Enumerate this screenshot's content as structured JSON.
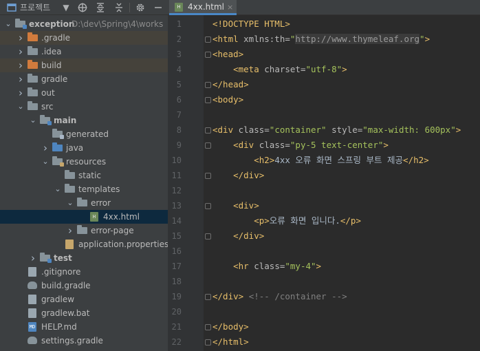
{
  "project_panel": {
    "title": "프로젝트",
    "tree": [
      {
        "indent": 0,
        "arrow": "open",
        "icon": "module",
        "label": "exception",
        "bold": true,
        "path": "D:\\dev\\Spring\\4\\works",
        "row": "normal"
      },
      {
        "indent": 1,
        "arrow": "closed",
        "icon": "folder-orange",
        "label": ".gradle",
        "row": "excluded"
      },
      {
        "indent": 1,
        "arrow": "closed",
        "icon": "folder-grey",
        "label": ".idea",
        "row": "normal"
      },
      {
        "indent": 1,
        "arrow": "closed",
        "icon": "folder-orange",
        "label": "build",
        "row": "excluded"
      },
      {
        "indent": 1,
        "arrow": "closed",
        "icon": "folder-grey",
        "label": "gradle",
        "row": "normal"
      },
      {
        "indent": 1,
        "arrow": "closed",
        "icon": "folder-grey",
        "label": "out",
        "row": "normal"
      },
      {
        "indent": 1,
        "arrow": "open",
        "icon": "folder-grey",
        "label": "src",
        "row": "normal"
      },
      {
        "indent": 2,
        "arrow": "open",
        "icon": "folder-module",
        "label": "main",
        "bold": true,
        "row": "normal"
      },
      {
        "indent": 3,
        "arrow": "none",
        "icon": "folder-generated",
        "label": "generated",
        "row": "normal"
      },
      {
        "indent": 3,
        "arrow": "closed",
        "icon": "folder-blue",
        "label": "java",
        "row": "normal"
      },
      {
        "indent": 3,
        "arrow": "open",
        "icon": "folder-resources",
        "label": "resources",
        "row": "normal"
      },
      {
        "indent": 4,
        "arrow": "none",
        "icon": "folder-grey",
        "label": "static",
        "row": "normal"
      },
      {
        "indent": 4,
        "arrow": "open",
        "icon": "folder-grey",
        "label": "templates",
        "row": "normal"
      },
      {
        "indent": 5,
        "arrow": "open",
        "icon": "folder-grey",
        "label": "error",
        "row": "normal"
      },
      {
        "indent": 6,
        "arrow": "none",
        "icon": "file-html",
        "label": "4xx.html",
        "row": "selected"
      },
      {
        "indent": 5,
        "arrow": "closed",
        "icon": "folder-grey",
        "label": "error-page",
        "row": "normal"
      },
      {
        "indent": 4,
        "arrow": "none",
        "icon": "file-properties",
        "label": "application.properties",
        "row": "normal"
      },
      {
        "indent": 2,
        "arrow": "closed",
        "icon": "folder-module",
        "label": "test",
        "bold": true,
        "row": "normal"
      },
      {
        "indent": 1,
        "arrow": "none",
        "icon": "file-generic",
        "label": ".gitignore",
        "row": "normal"
      },
      {
        "indent": 1,
        "arrow": "none",
        "icon": "gradle-elephant",
        "label": "build.gradle",
        "row": "normal"
      },
      {
        "indent": 1,
        "arrow": "none",
        "icon": "file-generic",
        "label": "gradlew",
        "row": "normal"
      },
      {
        "indent": 1,
        "arrow": "none",
        "icon": "file-generic",
        "label": "gradlew.bat",
        "row": "normal"
      },
      {
        "indent": 1,
        "arrow": "none",
        "icon": "file-md",
        "label": "HELP.md",
        "row": "normal"
      },
      {
        "indent": 1,
        "arrow": "none",
        "icon": "gradle-elephant",
        "label": "settings.gradle",
        "row": "normal"
      }
    ]
  },
  "editor": {
    "tab": {
      "label": "4xx.html",
      "close_glyph": "×"
    },
    "lines": [
      {
        "n": "1",
        "fold": false,
        "tokens": [
          [
            "t-doctype",
            "<!DOCTYPE HTML>"
          ]
        ]
      },
      {
        "n": "2",
        "fold": true,
        "tokens": [
          [
            "t-tag",
            "<html "
          ],
          [
            "t-attr",
            "xmlns:th="
          ],
          [
            "t-val",
            "\""
          ],
          [
            "url-hl",
            "http://www.thymeleaf.org"
          ],
          [
            "t-val",
            "\""
          ],
          [
            "t-tag",
            ">"
          ]
        ]
      },
      {
        "n": "3",
        "fold": true,
        "tokens": [
          [
            "t-tag",
            "<head>"
          ]
        ]
      },
      {
        "n": "4",
        "fold": false,
        "tokens": [
          [
            "t-text",
            "    "
          ],
          [
            "t-tag",
            "<meta "
          ],
          [
            "t-attr",
            "charset="
          ],
          [
            "t-val",
            "\"utf-8\""
          ],
          [
            "t-tag",
            ">"
          ]
        ]
      },
      {
        "n": "5",
        "fold": true,
        "tokens": [
          [
            "t-tag",
            "</head>"
          ]
        ]
      },
      {
        "n": "6",
        "fold": true,
        "tokens": [
          [
            "t-tag",
            "<body>"
          ]
        ]
      },
      {
        "n": "7",
        "fold": false,
        "tokens": []
      },
      {
        "n": "8",
        "fold": true,
        "tokens": [
          [
            "t-tag",
            "<div "
          ],
          [
            "t-attr",
            "class="
          ],
          [
            "t-val",
            "\"container\" "
          ],
          [
            "t-attr",
            "style="
          ],
          [
            "t-val",
            "\"max-width: 600px\""
          ],
          [
            "t-tag",
            ">"
          ]
        ]
      },
      {
        "n": "9",
        "fold": true,
        "tokens": [
          [
            "t-text",
            "    "
          ],
          [
            "t-tag",
            "<div "
          ],
          [
            "t-attr",
            "class="
          ],
          [
            "t-val",
            "\"py-5 text-center\""
          ],
          [
            "t-tag",
            ">"
          ]
        ]
      },
      {
        "n": "10",
        "fold": false,
        "tokens": [
          [
            "t-text",
            "        "
          ],
          [
            "t-tag",
            "<h2>"
          ],
          [
            "t-text",
            "4xx 오류 화면 스프링 부트 제공"
          ],
          [
            "t-tag",
            "</h2>"
          ]
        ]
      },
      {
        "n": "11",
        "fold": true,
        "tokens": [
          [
            "t-text",
            "    "
          ],
          [
            "t-tag",
            "</div>"
          ]
        ]
      },
      {
        "n": "12",
        "fold": false,
        "tokens": []
      },
      {
        "n": "13",
        "fold": true,
        "tokens": [
          [
            "t-text",
            "    "
          ],
          [
            "t-tag",
            "<div>"
          ]
        ]
      },
      {
        "n": "14",
        "fold": false,
        "tokens": [
          [
            "t-text",
            "        "
          ],
          [
            "t-tag",
            "<p>"
          ],
          [
            "t-text",
            "오류 화면 입니다."
          ],
          [
            "t-tag",
            "</p>"
          ]
        ]
      },
      {
        "n": "15",
        "fold": true,
        "tokens": [
          [
            "t-text",
            "    "
          ],
          [
            "t-tag",
            "</div>"
          ]
        ]
      },
      {
        "n": "16",
        "fold": false,
        "tokens": []
      },
      {
        "n": "17",
        "fold": false,
        "tokens": [
          [
            "t-text",
            "    "
          ],
          [
            "t-tag",
            "<hr "
          ],
          [
            "t-attr",
            "class="
          ],
          [
            "t-val",
            "\"my-4\""
          ],
          [
            "t-tag",
            ">"
          ]
        ]
      },
      {
        "n": "18",
        "fold": false,
        "tokens": []
      },
      {
        "n": "19",
        "fold": true,
        "tokens": [
          [
            "t-tag",
            "</div> "
          ],
          [
            "t-comment",
            "<!-- /container -->"
          ]
        ]
      },
      {
        "n": "20",
        "fold": false,
        "tokens": []
      },
      {
        "n": "21",
        "fold": true,
        "tokens": [
          [
            "t-tag",
            "</body>"
          ]
        ]
      },
      {
        "n": "22",
        "fold": true,
        "tokens": [
          [
            "t-tag",
            "</html>"
          ]
        ]
      }
    ]
  },
  "colors": {
    "panel_bg": "#3c3f41",
    "editor_bg": "#2b2b2b",
    "selected_row": "#0d293e",
    "excluded_row": "#45423b",
    "tag": "#e8bf6a",
    "attr_value": "#a5c25c",
    "tab_underline": "#4a88c7"
  },
  "icons": {
    "toolbar": [
      "project-folder-icon",
      "dropdown-icon",
      "locate-target-icon",
      "expand-all-icon",
      "collapse-all-icon",
      "gear-icon",
      "minimize-icon"
    ]
  }
}
